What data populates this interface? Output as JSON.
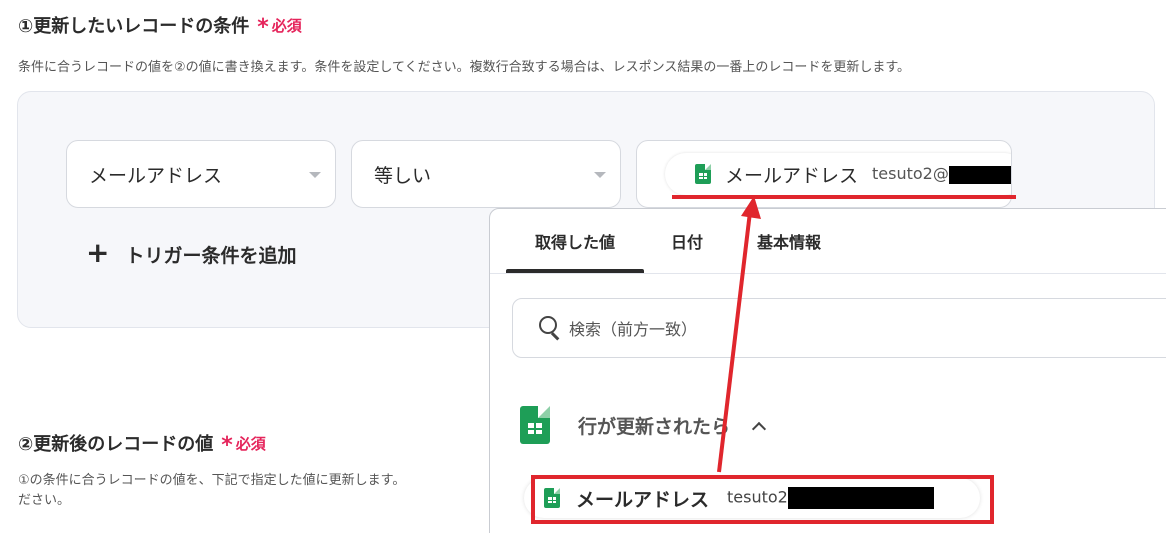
{
  "section1": {
    "title": "①更新したいレコードの条件",
    "required_label": "必須",
    "description": "条件に合うレコードの値を②の値に書き換えます。条件を設定してください。複数行合致する場合は、レスポンス結果の一番上のレコードを更新します。"
  },
  "condition": {
    "field_select": "メールアドレス",
    "operator_select": "等しい",
    "value_chip_label": "メールアドレス",
    "value_chip_value": "tesuto2@",
    "add_trigger_label": "トリガー条件を追加"
  },
  "section2": {
    "title": "②更新後のレコードの値",
    "required_label": "必須",
    "description_line1": "①の条件に合うレコードの値を、下記で指定した値に更新します。",
    "description_line2": "ださい。"
  },
  "panel": {
    "tabs": [
      {
        "label": "取得した値",
        "active": true
      },
      {
        "label": "日付",
        "active": false
      },
      {
        "label": "基本情報",
        "active": false
      }
    ],
    "search_placeholder": "検索（前方一致）",
    "group_title": "行が更新されたら",
    "item_label": "メールアドレス",
    "item_value": "tesuto2"
  },
  "colors": {
    "accent_red": "#e0262d",
    "required_pink": "#e5245b",
    "sheets_green": "#1e9e57"
  },
  "icons": [
    "sheets-icon",
    "search-icon",
    "chevron-up-icon",
    "plus-icon",
    "caret-down-icon"
  ]
}
